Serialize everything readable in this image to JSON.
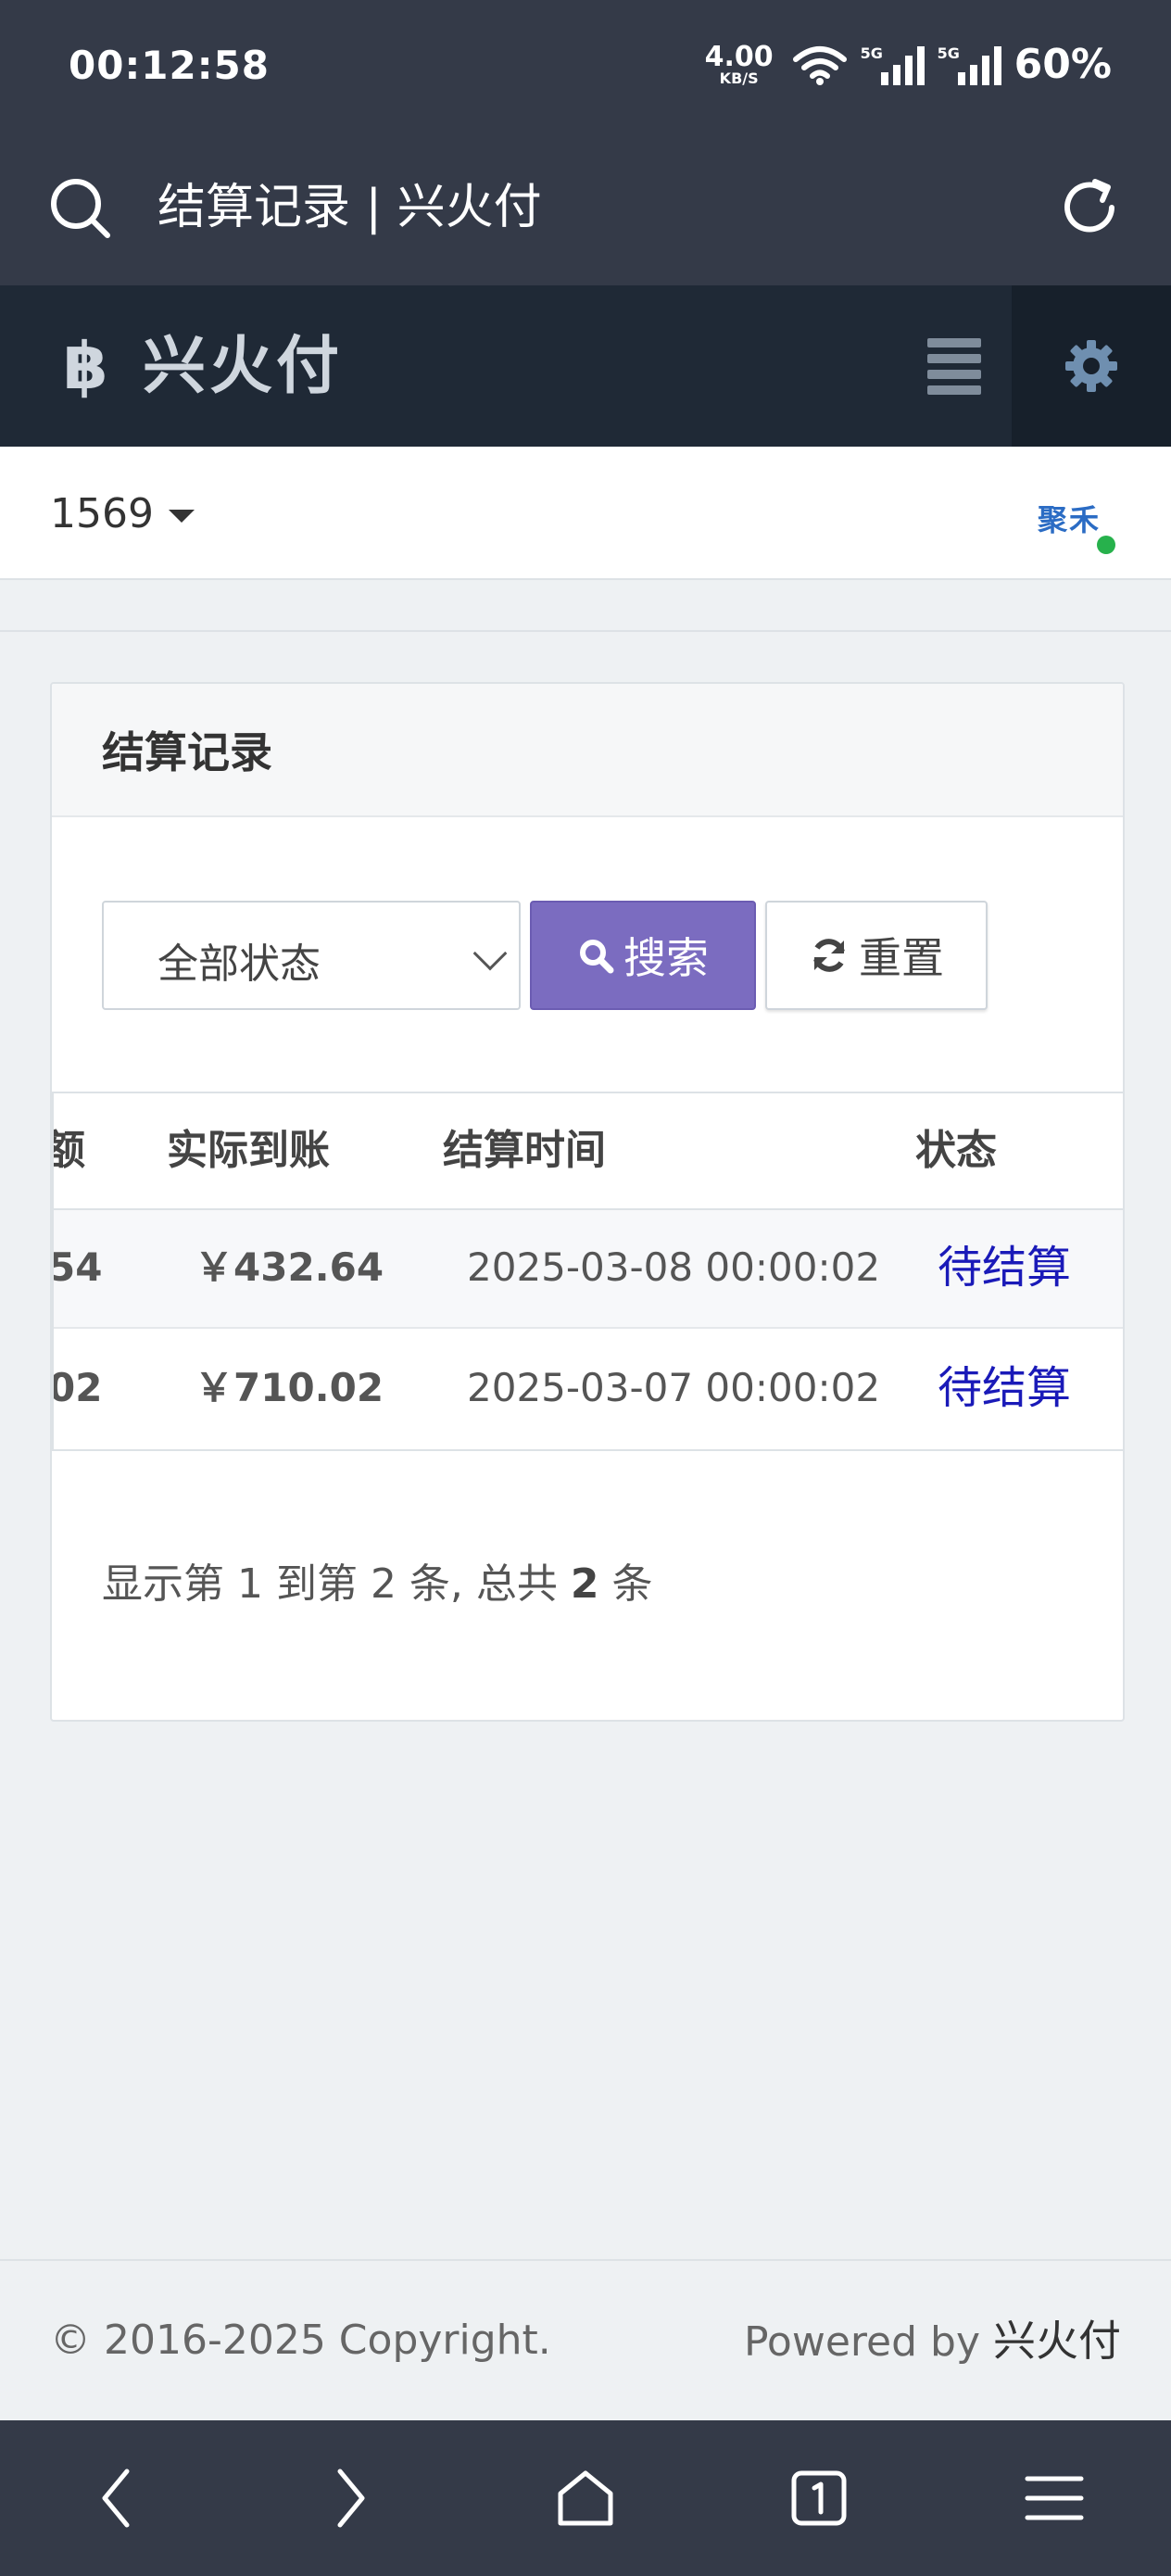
{
  "status_bar": {
    "time": "00:12:58",
    "net_speed": "4.00",
    "net_unit": "KB/S",
    "net_sub": "5",
    "signal1_tag": "5G",
    "signal2_tag": "5G",
    "battery": "60%"
  },
  "browser": {
    "page_title": "结算记录 | 兴火付"
  },
  "app": {
    "brand_icon": "฿",
    "brand_name": "兴火付",
    "merchant_id": "1569",
    "avatar_text": "聚禾"
  },
  "card": {
    "title": "结算记录",
    "filter": {
      "status_selected": "全部状态",
      "search_label": "搜索",
      "reset_label": "重置"
    },
    "table": {
      "columns": [
        "额",
        "实际到账",
        "结算时间",
        "状态"
      ],
      "rows": [
        {
          "amount_cut": "54",
          "actual": "￥432.64",
          "time": "2025-03-08 00:00:02",
          "status": "待结算"
        },
        {
          "amount_cut": "02",
          "actual": "￥710.02",
          "time": "2025-03-07 00:00:02",
          "status": "待结算"
        }
      ]
    },
    "pagination": {
      "prefix": "显示第 1 到第 2 条, 总共",
      "total": "2",
      "suffix": "条"
    }
  },
  "footer": {
    "copyright": "© 2016-2025 Copyright.",
    "powered_prefix": "Powered by",
    "powered_brand": "兴火付"
  },
  "colors": {
    "chrome": "#343a48",
    "header": "#1f2936",
    "search_button": "#7b6cc0",
    "status_link": "#1a1ab8",
    "online": "#27b14c"
  }
}
